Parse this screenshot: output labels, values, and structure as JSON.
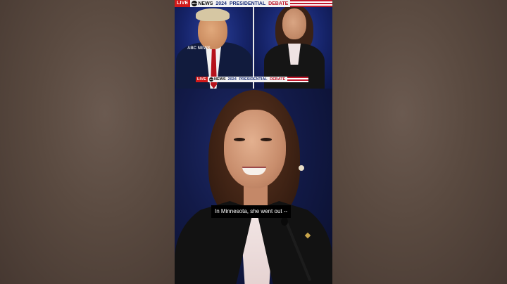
{
  "banner": {
    "live_label": "LIVE",
    "network": "NEWS",
    "network_logo": "abc",
    "year": "2024",
    "title_word1": "PRESIDENTIAL",
    "title_word2": "DEBATE"
  },
  "lower_banner": {
    "live_label": "LIVE",
    "network": "NEWS",
    "network_logo": "abc",
    "year": "2024",
    "title_word1": "PRESIDENTIAL",
    "title_word2": "DEBATE"
  },
  "watermark": "ABC NEWS",
  "caption": "In Minnesota, she went out --",
  "colors": {
    "live_red": "#d11a1a",
    "debate_blue": "#1a2f7a",
    "debate_red": "#c0182b",
    "stage_blue": "#16246a",
    "side_brown": "#5a4a40"
  },
  "icons": {
    "network_logo_icon": "abc-circle-logo",
    "flag_stripe_icon": "flag-stripes"
  }
}
